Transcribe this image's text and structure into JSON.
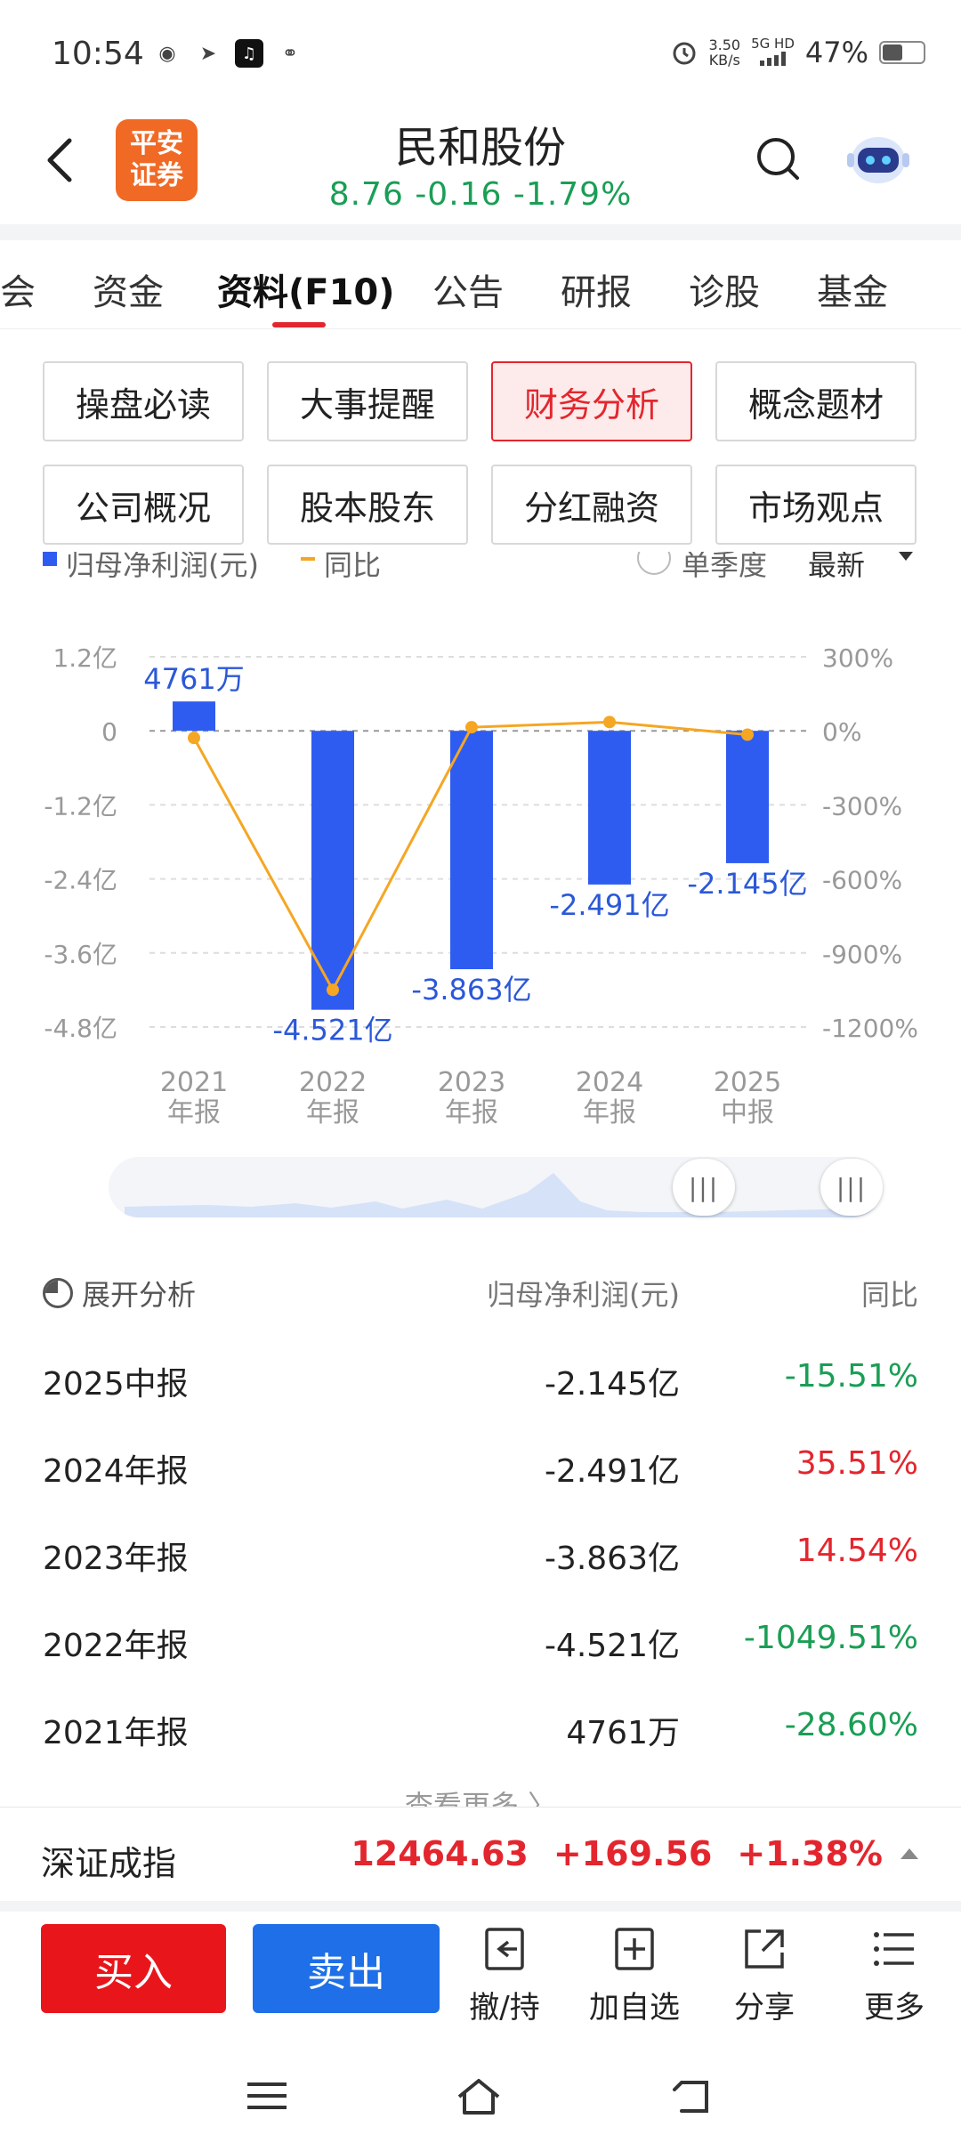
{
  "status": {
    "time": "10:54",
    "speed_value": "3.50",
    "speed_unit": "KB/s",
    "network": "5G HD",
    "battery": "47%"
  },
  "header": {
    "logo_line1": "平安",
    "logo_line2": "证券",
    "stock_name": "民和股份",
    "price": "8.76",
    "change": "-0.16",
    "change_pct": "-1.79%"
  },
  "tabs": [
    {
      "label": "会"
    },
    {
      "label": "资金"
    },
    {
      "label": "资料(F10)"
    },
    {
      "label": "公告"
    },
    {
      "label": "研报"
    },
    {
      "label": "诊股"
    },
    {
      "label": "基金"
    }
  ],
  "quick_buttons": [
    {
      "label": "操盘必读"
    },
    {
      "label": "大事提醒"
    },
    {
      "label": "财务分析"
    },
    {
      "label": "概念题材"
    },
    {
      "label": "公司概况"
    },
    {
      "label": "股本股东"
    },
    {
      "label": "分红融资"
    },
    {
      "label": "市场观点"
    }
  ],
  "legend": {
    "series1": "归母净利润(元)",
    "series2": "同比",
    "option": "单季度",
    "dropdown": "最新"
  },
  "chart_data": {
    "type": "bar",
    "categories": [
      "2021\n年报",
      "2022\n年报",
      "2023\n年报",
      "2024\n年报",
      "2025\n中报"
    ],
    "category_lines": [
      [
        "2021",
        "年报"
      ],
      [
        "2022",
        "年报"
      ],
      [
        "2023",
        "年报"
      ],
      [
        "2024",
        "年报"
      ],
      [
        "2025",
        "中报"
      ]
    ],
    "series": [
      {
        "name": "归母净利润(元)",
        "type": "bar",
        "values": [
          47610000,
          -452100000,
          -386300000,
          -249100000,
          -214500000
        ],
        "labels": [
          "4761万",
          "-4.521亿",
          "-3.863亿",
          "-2.491亿",
          "-2.145亿"
        ],
        "color": "#2f5cf0"
      },
      {
        "name": "同比",
        "type": "line",
        "values": [
          -28.6,
          -1049.51,
          14.54,
          35.51,
          -15.51
        ],
        "color": "#f5a623"
      }
    ],
    "y_left": {
      "ticks": [
        "1.2亿",
        "0",
        "-1.2亿",
        "-2.4亿",
        "-3.6亿",
        "-4.8亿"
      ],
      "range": [
        -480000000,
        120000000
      ]
    },
    "y_right": {
      "ticks": [
        "300%",
        "0%",
        "-300%",
        "-600%",
        "-900%",
        "-1200%"
      ],
      "range": [
        -1200,
        300
      ]
    }
  },
  "table": {
    "head_left": "展开分析",
    "head_mid": "归母净利润(元)",
    "head_right": "同比",
    "rows": [
      {
        "period": "2025中报",
        "value": "-2.145亿",
        "yoy": "-15.51%",
        "color": "green"
      },
      {
        "period": "2024年报",
        "value": "-2.491亿",
        "yoy": "35.51%",
        "color": "red"
      },
      {
        "period": "2023年报",
        "value": "-3.863亿",
        "yoy": "14.54%",
        "color": "red"
      },
      {
        "period": "2022年报",
        "value": "-4.521亿",
        "yoy": "-1049.51%",
        "color": "green"
      },
      {
        "period": "2021年报",
        "value": "4761万",
        "yoy": "-28.60%",
        "color": "green"
      }
    ],
    "more": "查看更多 〉"
  },
  "ticker": {
    "name": "深证成指",
    "value": "12464.63",
    "change": "+169.56",
    "pct": "+1.38%"
  },
  "trade": {
    "buy": "买入",
    "sell": "卖出",
    "tools": [
      {
        "label": "撤/持",
        "icon": "withdraw-icon"
      },
      {
        "label": "加自选",
        "icon": "add-watchlist-icon"
      },
      {
        "label": "分享",
        "icon": "share-icon"
      },
      {
        "label": "更多",
        "icon": "more-icon"
      }
    ]
  },
  "colors": {
    "accent_red": "#e3262e",
    "down_green": "#1a9e55",
    "bar_blue": "#2f5cf0",
    "line_orange": "#f5a623",
    "sell_blue": "#1e6fe8"
  }
}
